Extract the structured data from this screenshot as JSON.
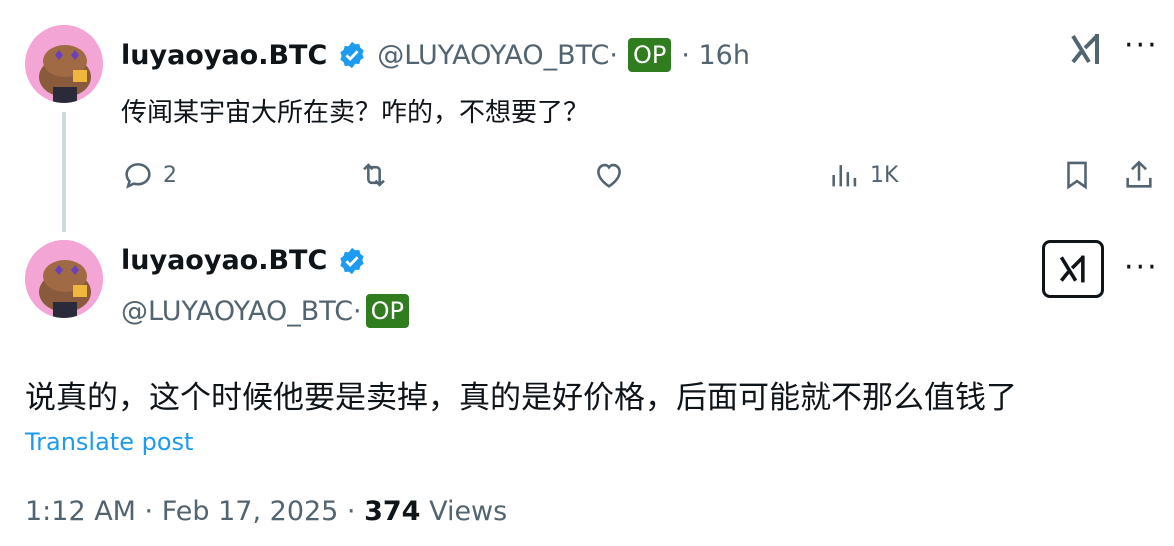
{
  "tweet1": {
    "name": "luyaoyao.BTC",
    "handle": "@LUYAOYAO_BTC·",
    "op": "OP",
    "time": "· 16h",
    "text": "传闻某宇宙大所在卖？咋的，不想要了？",
    "reply_count": "2",
    "views": "1K"
  },
  "tweet2": {
    "name": "luyaoyao.BTC",
    "handle": "@LUYAOYAO_BTC·",
    "op": "OP",
    "text": "说真的，这个时候他要是卖掉，真的是好价格，后面可能就不那么值钱了",
    "translate": "Translate post",
    "timestamp": "1:12 AM · Feb 17, 2025 · ",
    "views_count": "374",
    "views_label": " Views"
  },
  "icons": {
    "grok": "grok-icon",
    "more": "more-icon",
    "reply": "reply-icon",
    "retweet": "retweet-icon",
    "like": "like-icon",
    "views": "views-icon",
    "bookmark": "bookmark-icon",
    "share": "share-icon"
  },
  "colors": {
    "verified": "#1d9bf0",
    "op_badge": "#2f7d1f",
    "link": "#1d9bf0",
    "secondary": "#536471"
  }
}
